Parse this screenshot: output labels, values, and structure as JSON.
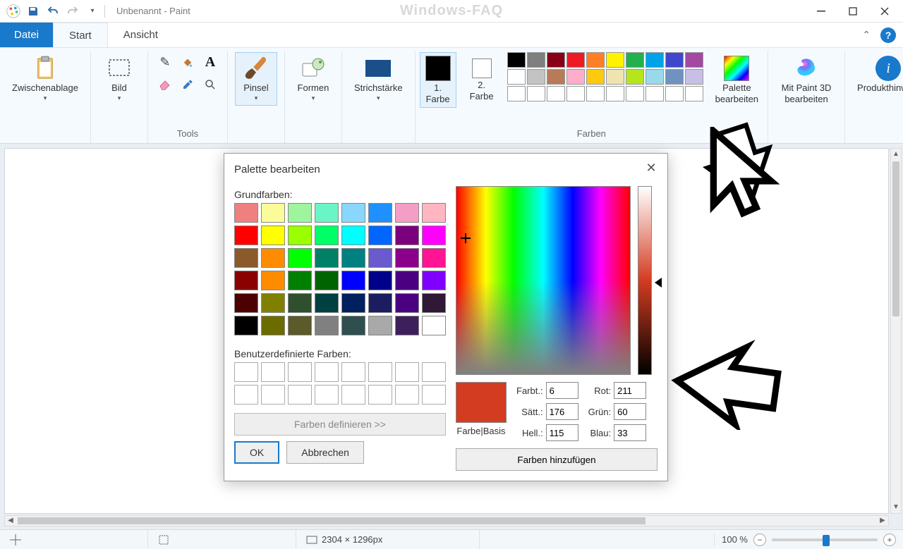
{
  "title": "Unbenannt - Paint",
  "watermark": "Windows-FAQ",
  "tabs": {
    "file": "Datei",
    "start": "Start",
    "view": "Ansicht"
  },
  "ribbon": {
    "clipboard": "Zwischenablage",
    "image": "Bild",
    "tools_group": "Tools",
    "brush": "Pinsel",
    "shapes": "Formen",
    "stroke": "Strichstärke",
    "color1": "1.\nFarbe",
    "color2": "2.\nFarbe",
    "colors_group": "Farben",
    "edit_palette": "Palette\nbearbeiten",
    "paint3d": "Mit Paint 3D\nbearbeiten",
    "product_notice": "Produkthinweis",
    "palette_colors": [
      "#000000",
      "#7f7f7f",
      "#880015",
      "#ed1c24",
      "#ff7f27",
      "#fff200",
      "#22b14c",
      "#00a2e8",
      "#3f48cc",
      "#a349a4",
      "#ffffff",
      "#c3c3c3",
      "#b97a57",
      "#ffaec9",
      "#ffc90e",
      "#efe4b0",
      "#b5e61d",
      "#99d9ea",
      "#7092be",
      "#c8bfe7",
      "#ffffff",
      "#ffffff",
      "#ffffff",
      "#ffffff",
      "#ffffff",
      "#ffffff",
      "#ffffff",
      "#ffffff",
      "#ffffff",
      "#ffffff"
    ]
  },
  "status": {
    "dimensions": "2304 × 1296px",
    "zoom": "100 %"
  },
  "dialog": {
    "title": "Palette bearbeiten",
    "basic_label": "Grundfarben:",
    "basic_colors": [
      "#f08080",
      "#fbfb9a",
      "#9ef59e",
      "#6af5c6",
      "#89d7fc",
      "#1e90ff",
      "#f59ec5",
      "#ffb6c1",
      "#ff0000",
      "#ffff00",
      "#9aff00",
      "#00ff66",
      "#00ffff",
      "#0066ff",
      "#7b007b",
      "#ff00ff",
      "#8b5a2b",
      "#ff8c00",
      "#00ff00",
      "#008066",
      "#008080",
      "#6a5acd",
      "#8b008b",
      "#ff1493",
      "#8b0000",
      "#ff8c00",
      "#008000",
      "#006400",
      "#0000ff",
      "#00008b",
      "#4b0082",
      "#8000ff",
      "#4d0000",
      "#808000",
      "#2f4f2f",
      "#004040",
      "#002060",
      "#1c1c60",
      "#4b0082",
      "#301934",
      "#000000",
      "#6b6b00",
      "#5a5a2a",
      "#808080",
      "#2f4f4f",
      "#a9a9a9",
      "#3d1f5c",
      "#ffffff"
    ],
    "custom_label": "Benutzerdefinierte Farben:",
    "define_btn": "Farben definieren >>",
    "ok": "OK",
    "cancel": "Abbrechen",
    "preview_label": "Farbe|Basis",
    "hue_l": "Farbt.:",
    "hue_v": "6",
    "sat_l": "Sätt.:",
    "sat_v": "176",
    "lum_l": "Hell.:",
    "lum_v": "115",
    "red_l": "Rot:",
    "red_v": "211",
    "grn_l": "Grün:",
    "grn_v": "60",
    "blu_l": "Blau:",
    "blu_v": "33",
    "add_btn": "Farben hinzufügen",
    "preview_color": "#d33c21"
  }
}
